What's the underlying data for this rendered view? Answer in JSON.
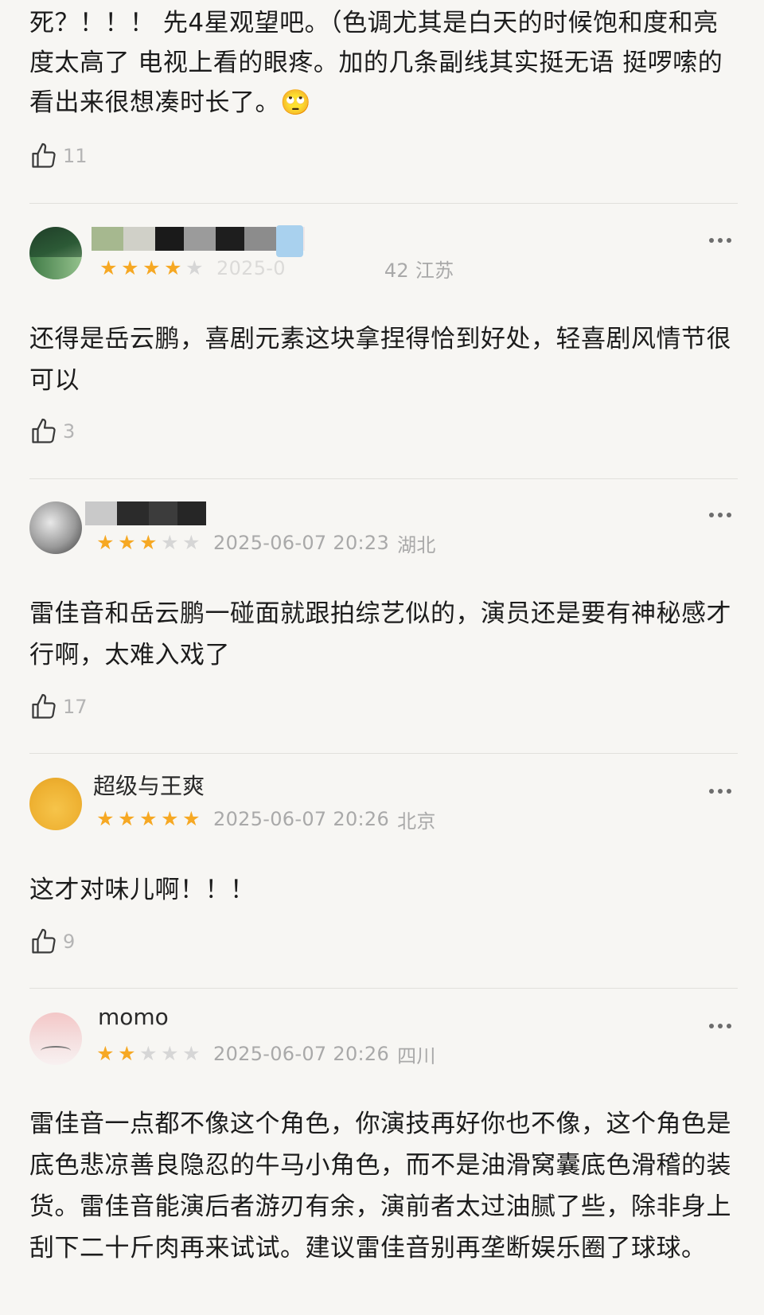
{
  "reviews": [
    {
      "text": "死？！！！ 先4星观望吧。（色调尤其是白天的时候饱和度和亮度太高了 电视上看的眼疼。加的几条副线其实挺无语 挺啰嗦的 看出来很想凑时长了。🙄",
      "likes": "11"
    },
    {
      "username": "Dl...",
      "stars": 4,
      "date": "2025-0",
      "location": "42 江苏",
      "text": "还得是岳云鹏，喜剧元素这块拿捏得恰到好处，轻喜剧风情节很可以",
      "likes": "3"
    },
    {
      "username": "",
      "stars": 3,
      "date": "2025-06-07 20:23",
      "location": "湖北",
      "text": "雷佳音和岳云鹏一碰面就跟拍综艺似的，演员还是要有神秘感才行啊，太难入戏了",
      "likes": "17"
    },
    {
      "username": "超级与王爽",
      "stars": 5,
      "date": "2025-06-07 20:26",
      "location": "北京",
      "text": "这才对味儿啊！！！",
      "likes": "9"
    },
    {
      "username": "momo",
      "stars": 2,
      "date": "2025-06-07 20:26",
      "location": "四川",
      "text": "雷佳音一点都不像这个角色，你演技再好你也不像，这个角色是底色悲凉善良隐忍的牛马小角色，而不是油滑窝囊底色滑稽的装货。雷佳音能演后者游刃有余，演前者太过油腻了些，除非身上刮下二十斤肉再来试试。建议雷佳音别再垄断娱乐圈了球球。"
    }
  ],
  "colors": {
    "star_on": "#f6a823",
    "star_off": "#d6d6d6",
    "meta_text": "#a9a9a9",
    "body_text": "#1c1c1c",
    "background": "#f7f6f3"
  },
  "icons": {
    "like": "thumbs-up-icon",
    "more": "more-dots-icon",
    "star": "star-icon"
  }
}
